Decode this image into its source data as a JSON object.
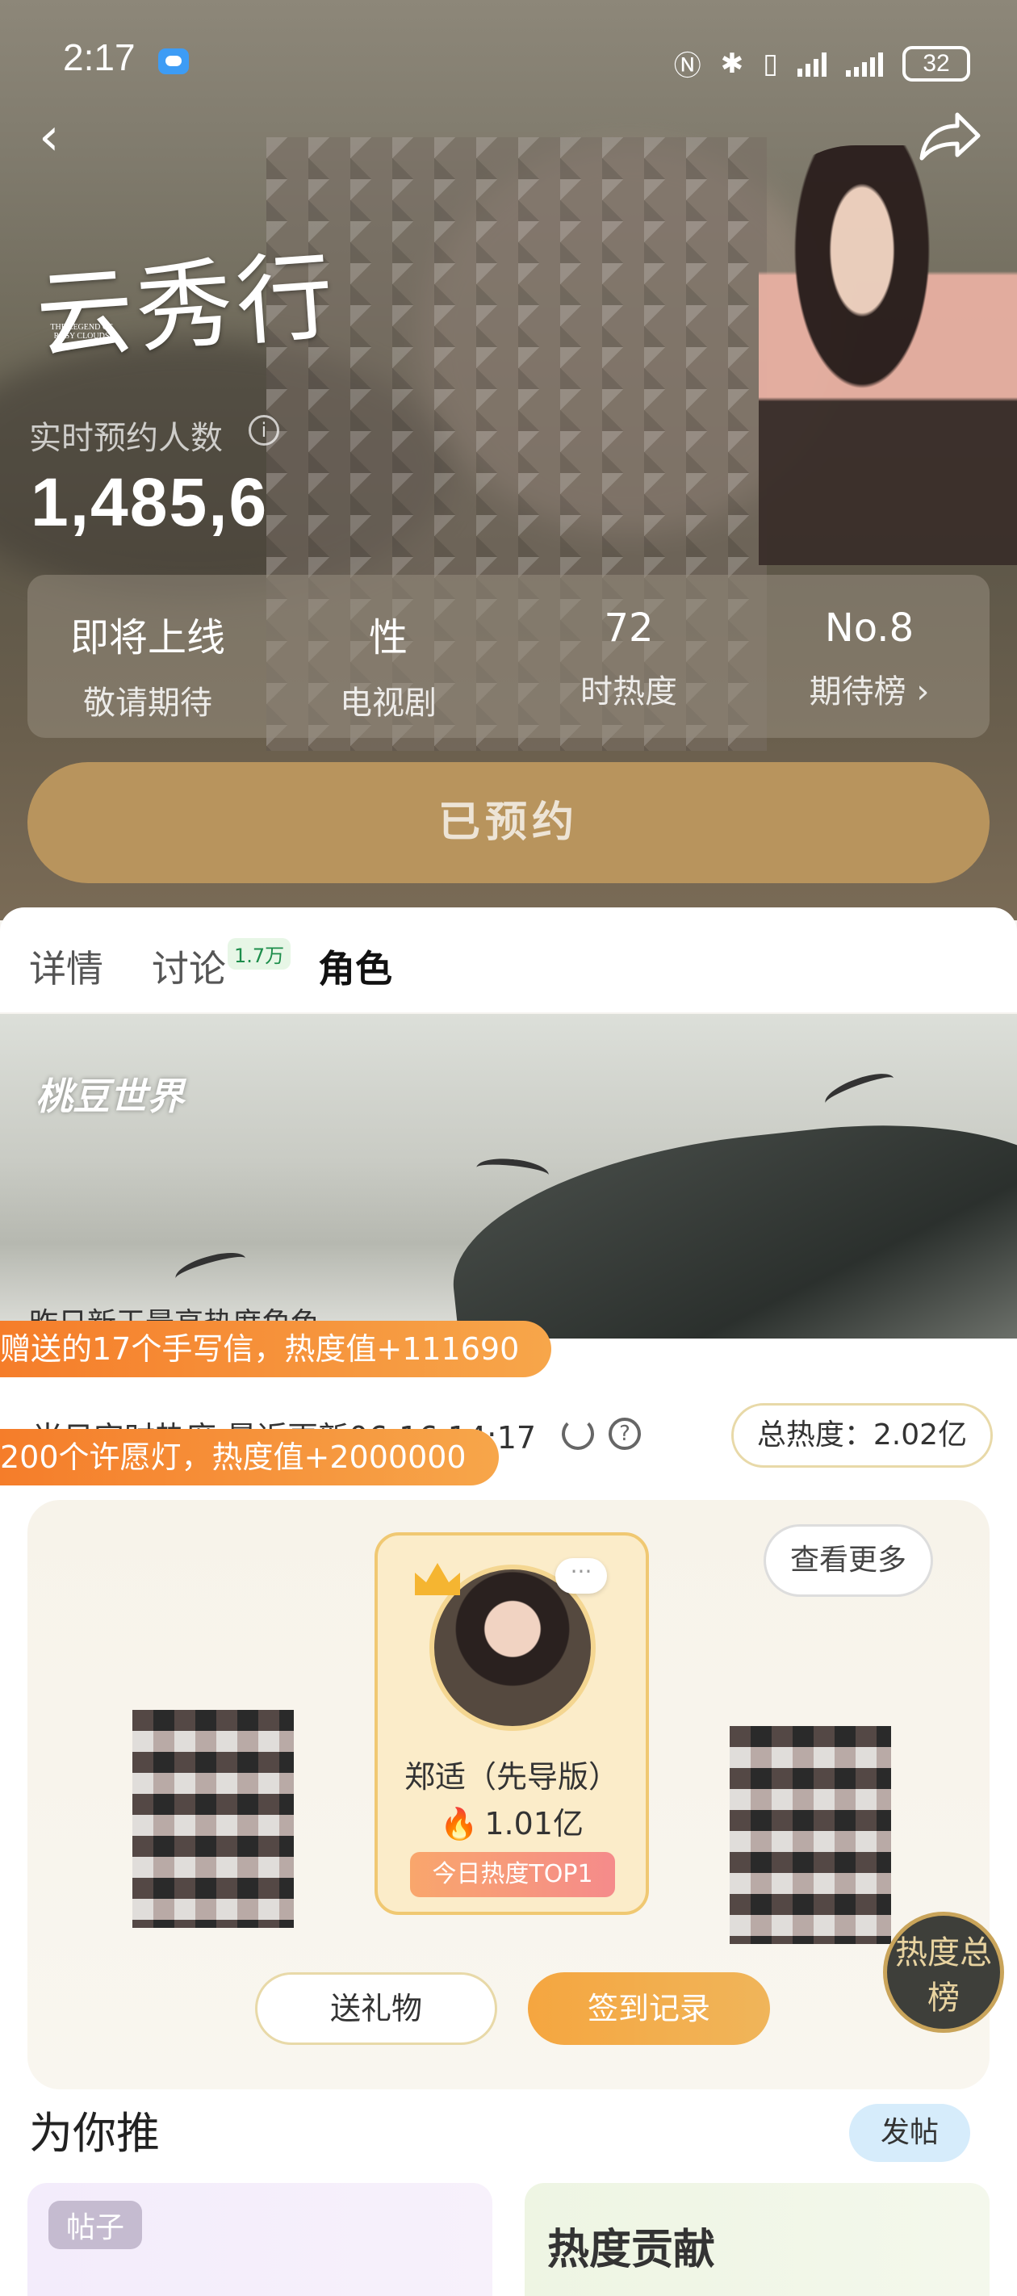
{
  "status_bar": {
    "time": "2:17",
    "battery": "32",
    "icons": [
      "chat-icon",
      "nfc-icon",
      "bluetooth-icon",
      "vibrate-icon",
      "signal-icon",
      "signal-icon",
      "battery-icon"
    ]
  },
  "nav": {
    "back_icon": "back-icon",
    "share_icon": "share-icon"
  },
  "show": {
    "title": "云秀行",
    "logo_subtitle": "THE LEGEND OF ROSY CLOUDS",
    "reserve_label": "实时预约人数",
    "reserve_count": "1,485,6"
  },
  "stats": [
    {
      "value": "即将上线",
      "label": "敬请期待"
    },
    {
      "value": "性",
      "label": "电视剧"
    },
    {
      "value": "72",
      "label": "时热度"
    },
    {
      "value": "No.8",
      "label": "期待榜 ›"
    }
  ],
  "reserved_button": "已预约",
  "tabs": [
    {
      "label": "详情",
      "active": false
    },
    {
      "label": "讨论",
      "badge": "1.7万",
      "active": false
    },
    {
      "label": "角色",
      "active": true
    }
  ],
  "banner": {
    "logo": "桃豆世界",
    "caption": "昨日新王最高热度角色"
  },
  "tickers": [
    "赠送的17个手写信，热度值+111690",
    "200个许愿灯，热度值+2000000"
  ],
  "update": {
    "text": "当日实时热度 最近更新06-16 14:17",
    "total_heat": "总热度：2.02亿"
  },
  "ranking": {
    "see_more": "查看更多",
    "top": {
      "name": "郑适（先导版）",
      "heat": "1.01亿",
      "badge": "今日热度TOP1",
      "bubble": "···"
    },
    "buttons": {
      "gift": "送礼物",
      "checkin": "签到记录"
    },
    "heat_badge": "热度总榜"
  },
  "recommend": {
    "title": "为你推",
    "post_button": "发帖",
    "cards": [
      {
        "tag": "帖子"
      },
      {
        "title": "热度贡献"
      }
    ]
  },
  "colors": {
    "accent": "#b8945d",
    "orange": "#f57d2a",
    "badge_green": "#1d8d4b"
  }
}
